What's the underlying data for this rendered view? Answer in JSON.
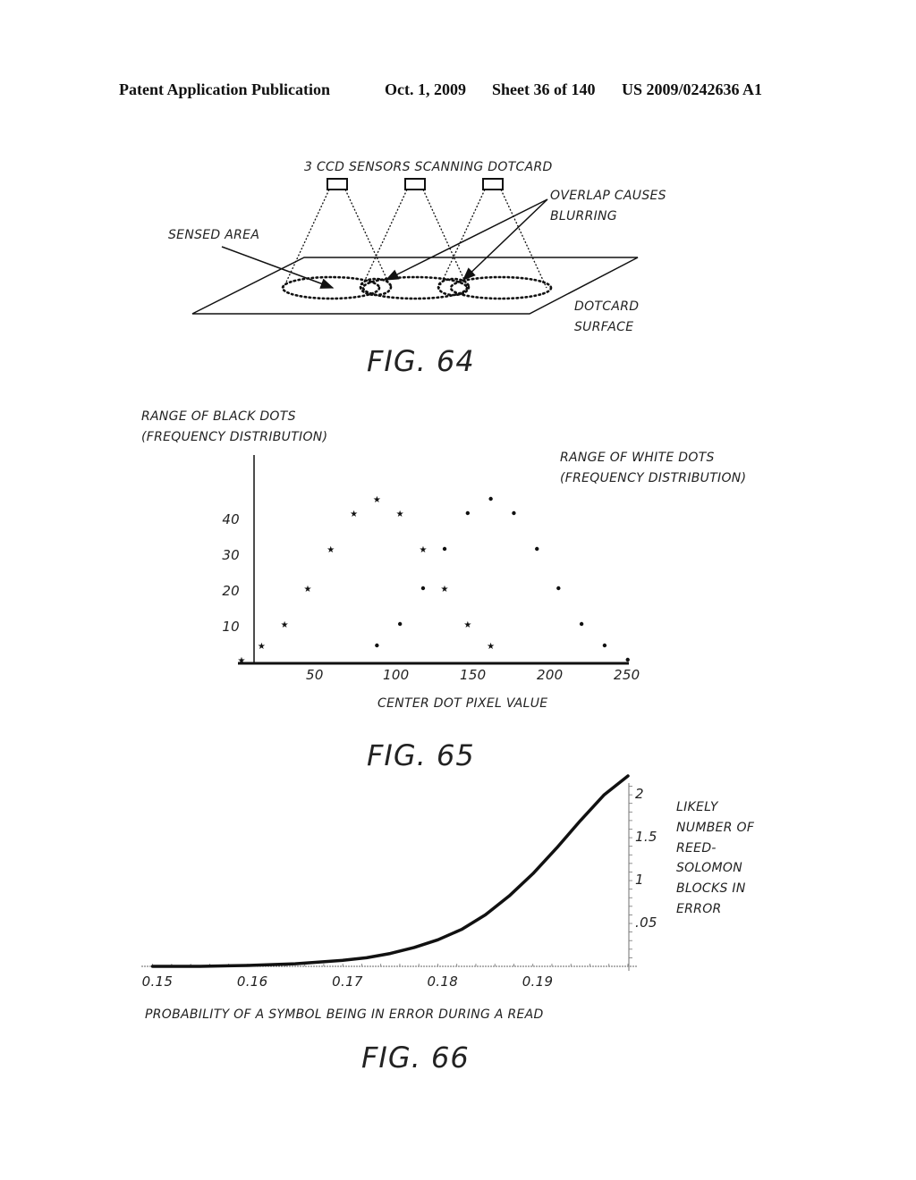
{
  "header": {
    "publication": "Patent Application Publication",
    "date": "Oct. 1, 2009",
    "sheet": "Sheet 36 of 140",
    "patent_number": "US 2009/0242636 A1"
  },
  "fig64": {
    "title": "3 CCD SENSORS SCANNING DOTCARD",
    "label_sensed_area": "SENSED AREA",
    "label_overlap_line1": "OVERLAP CAUSES",
    "label_overlap_line2": "BLURRING",
    "label_surface_line1": "DOTCARD",
    "label_surface_line2": "SURFACE",
    "caption": "FIG. 64",
    "sensor_count": 3
  },
  "fig65": {
    "caption": "FIG. 65",
    "legend_black_line1": "RANGE OF BLACK DOTS",
    "legend_black_line2": "(FREQUENCY DISTRIBUTION)",
    "legend_white_line1": "RANGE OF WHITE DOTS",
    "legend_white_line2": "(FREQUENCY DISTRIBUTION)"
  },
  "fig66": {
    "caption": "FIG. 66",
    "ylabel_lines": [
      "LIKELY",
      "NUMBER OF",
      "REED-",
      "SOLOMON",
      "BLOCKS IN",
      "ERROR"
    ]
  },
  "chart_data": [
    {
      "type": "scatter",
      "title": "",
      "xlabel": "CENTER DOT PIXEL VALUE",
      "ylabel": "",
      "xlim": [
        0,
        255
      ],
      "ylim": [
        0,
        50
      ],
      "grid": false,
      "x_ticks": [
        50,
        100,
        150,
        200,
        250
      ],
      "x_tick_labels": [
        "50",
        "100",
        "150",
        "200",
        "250"
      ],
      "y_ticks": [
        10,
        20,
        30,
        40
      ],
      "y_tick_labels": [
        "10",
        "20",
        "30",
        "40"
      ],
      "series": [
        {
          "name": "RANGE OF BLACK DOTS (FREQUENCY DISTRIBUTION)",
          "marker": "star",
          "x": [
            0,
            13,
            28,
            43,
            58,
            73,
            88,
            103,
            118,
            132,
            147,
            162
          ],
          "y": [
            1,
            5,
            11,
            21,
            32,
            42,
            46,
            42,
            32,
            21,
            11,
            5
          ]
        },
        {
          "name": "RANGE OF WHITE DOTS (FREQUENCY DISTRIBUTION)",
          "marker": "dot",
          "x": [
            88,
            103,
            118,
            132,
            147,
            162,
            177,
            192,
            206,
            221,
            236,
            251
          ],
          "y": [
            5,
            11,
            21,
            32,
            42,
            46,
            42,
            32,
            21,
            11,
            5,
            1
          ]
        }
      ]
    },
    {
      "type": "line",
      "title": "",
      "xlabel": "PROBABILITY OF A SYMBOL BEING IN ERROR DURING A READ",
      "ylabel": "LIKELY NUMBER OF REED-SOLOMON BLOCKS IN ERROR",
      "xlim": [
        0.149,
        0.2
      ],
      "ylim": [
        0,
        2.2
      ],
      "grid": false,
      "x_ticks": [
        0.15,
        0.16,
        0.17,
        0.18,
        0.19
      ],
      "x_tick_labels": [
        "0.15",
        "0.16",
        "0.17",
        "0.18",
        "0.19"
      ],
      "y_ticks": [
        0.5,
        1,
        1.5,
        2
      ],
      "y_tick_labels": [
        ".05",
        "1",
        "1.5",
        "2"
      ],
      "series": [
        {
          "name": "blocks in error",
          "x": [
            0.15,
            0.155,
            0.16,
            0.165,
            0.17,
            0.1725,
            0.175,
            0.1775,
            0.18,
            0.1825,
            0.185,
            0.1875,
            0.19,
            0.1925,
            0.195,
            0.1975,
            0.2
          ],
          "y": [
            0.0,
            0.0,
            0.01,
            0.03,
            0.07,
            0.1,
            0.15,
            0.22,
            0.31,
            0.43,
            0.6,
            0.82,
            1.08,
            1.38,
            1.7,
            2.0,
            2.22
          ]
        }
      ]
    }
  ]
}
